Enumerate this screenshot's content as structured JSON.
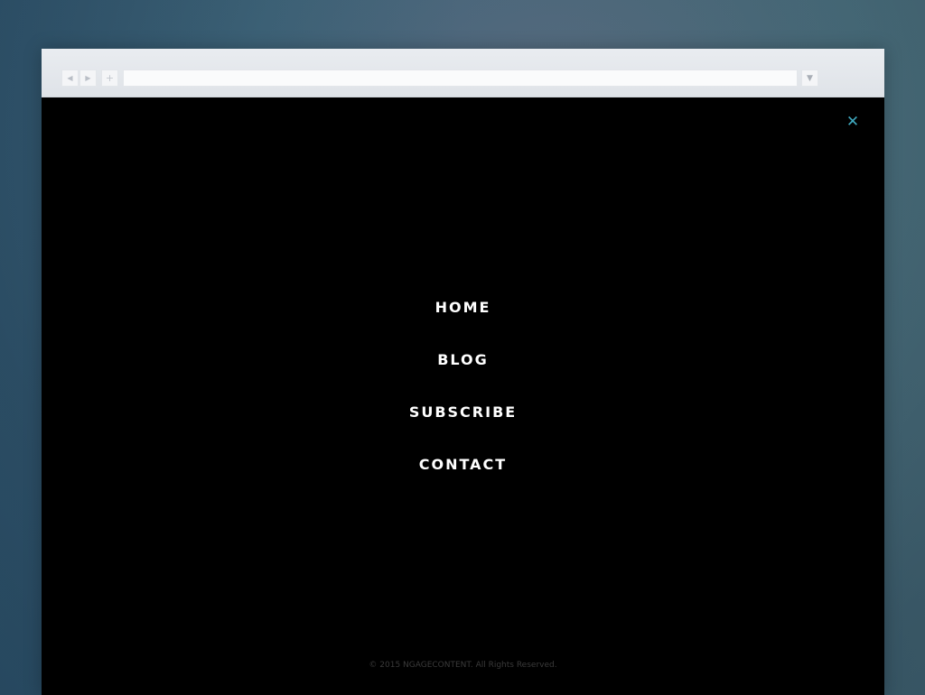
{
  "browser": {
    "back_icon": "◀",
    "forward_icon": "▶",
    "new_tab_icon": "+",
    "address_value": "",
    "dropdown_icon": "▼"
  },
  "overlay": {
    "close_icon": "✕",
    "close_color": "#3fa9bf",
    "menu": [
      {
        "label": "HOME"
      },
      {
        "label": "BLOG"
      },
      {
        "label": "SUBSCRIBE"
      },
      {
        "label": "CONTACT"
      }
    ],
    "footer_text": "© 2015 NGAGECONTENT. All Rights Reserved."
  }
}
